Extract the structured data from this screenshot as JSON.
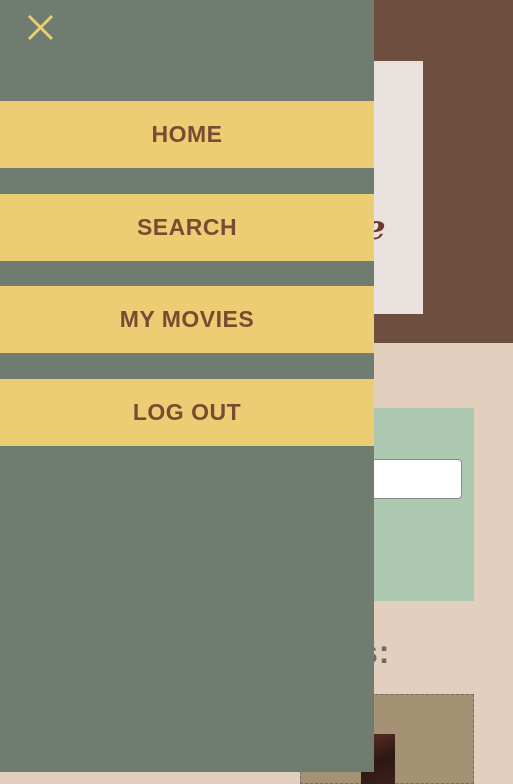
{
  "drawer": {
    "close_icon": "close-icon",
    "nav_items": [
      {
        "label": "HOME"
      },
      {
        "label": "SEARCH"
      },
      {
        "label": "MY MOVIES"
      },
      {
        "label": "LOG OUT"
      }
    ]
  },
  "background": {
    "logo_fragment": "e",
    "section_heading_fragment": "s:"
  },
  "colors": {
    "drawer_bg": "#717c71",
    "nav_item_bg": "#eccd74",
    "nav_item_text": "#7a4b32",
    "close_icon": "#eccd74",
    "header_bg": "#6e4e3f",
    "page_bg": "#e2cfbd",
    "form_panel_bg": "#adc8b0"
  }
}
